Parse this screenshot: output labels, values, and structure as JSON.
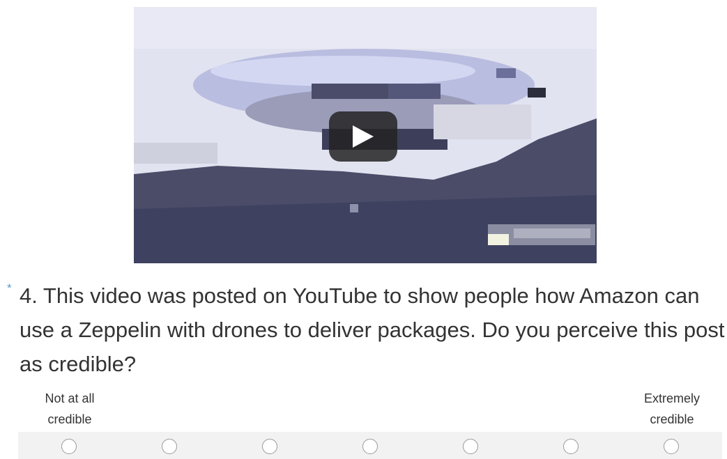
{
  "video": {
    "play_button_icon": "play-icon"
  },
  "question": {
    "required_marker": "*",
    "text": "4. This video was posted on YouTube to show people how Amazon can use a Zeppelin with drones to deliver packages.  Do you perceive this post as credible?"
  },
  "scale": {
    "low_label": "Not at all\ncredible",
    "high_label": "Extremely\ncredible",
    "options": 7,
    "selected": null
  },
  "colors": {
    "required_star": "#5a9bc4",
    "radio_row_bg": "#f2f2f2",
    "play_button_bg": "#232323"
  }
}
